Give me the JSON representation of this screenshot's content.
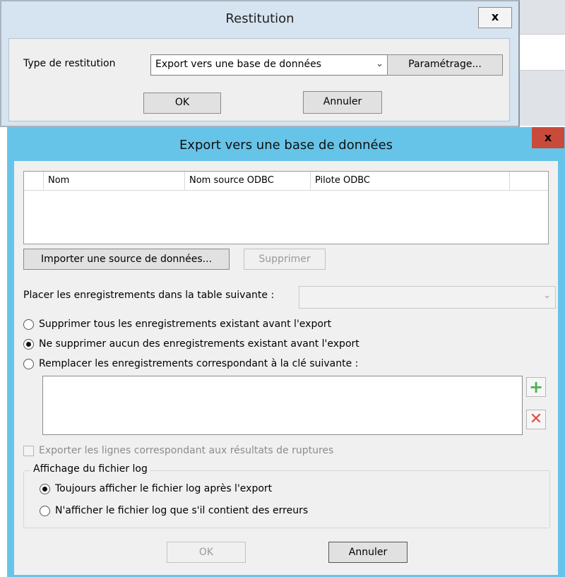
{
  "restitution": {
    "title": "Restitution",
    "close_glyph": "x",
    "type_label": "Type de restitution",
    "type_value": "Export vers une base de données",
    "settings_button": "Paramétrage...",
    "ok_button": "OK",
    "cancel_button": "Annuler"
  },
  "export": {
    "title": "Export vers une base de données",
    "close_glyph": "x",
    "columns": [
      "Nom",
      "Nom source ODBC",
      "Pilote ODBC"
    ],
    "import_button": "Importer une source de données...",
    "delete_button": "Supprimer",
    "table_label": "Placer les enregistrements dans la table suivante :",
    "table_value": "",
    "options": [
      {
        "label": "Supprimer tous les enregistrements existant avant l'export",
        "selected": false
      },
      {
        "label": "Ne supprimer aucun des enregistrements existant avant l'export",
        "selected": true
      },
      {
        "label": "Remplacer les enregistrements correspondant à la clé suivante :",
        "selected": false
      }
    ],
    "add_icon": "plus-icon",
    "remove_icon": "delete-x-icon",
    "export_breaks_label": "Exporter les lignes correspondant aux résultats de ruptures",
    "log_group_title": "Affichage du fichier log",
    "log_options": [
      {
        "label": "Toujours afficher le fichier log après l'export",
        "selected": true
      },
      {
        "label": "N'afficher le fichier log que s'il contient des erreurs",
        "selected": false
      }
    ],
    "ok_button": "OK",
    "cancel_button": "Annuler"
  },
  "colors": {
    "export_titlebar": "#67c4e9",
    "close_button": "#c94a3b",
    "dialog_face": "#f0f0f0",
    "add_green": "#4caf50",
    "remove_red": "#e04a3a"
  }
}
